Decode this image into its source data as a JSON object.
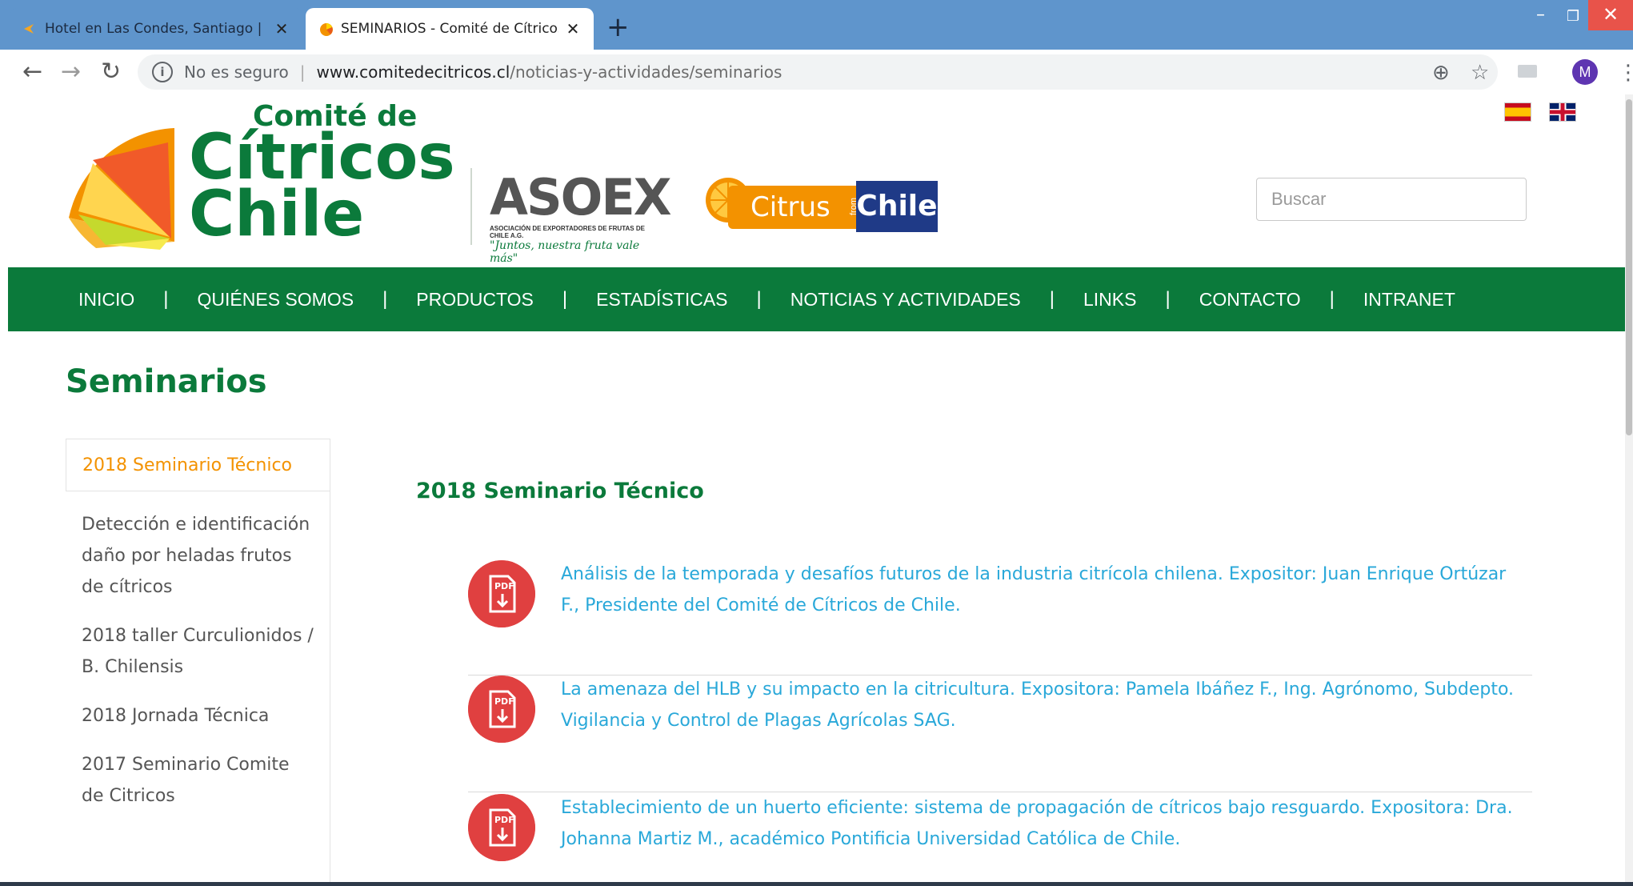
{
  "browser": {
    "tabs": [
      {
        "title": "Hotel en Las Condes, Santiago | "
      },
      {
        "title": "SEMINARIOS - Comité de Cítricos"
      }
    ],
    "close_glyph": "✕",
    "new_tab_glyph": "+",
    "window_controls": {
      "minimize": "–",
      "restore": "❐",
      "close": "✕"
    },
    "nav": {
      "back": "←",
      "forward": "→",
      "reload": "↻"
    },
    "address": {
      "info_glyph": "i",
      "security_text": "No es seguro",
      "separator": "|",
      "domain": "www.comitedecitricos.cl",
      "path": "/noticias-y-actividades/seminarios"
    },
    "toolbar_icons": {
      "zoom": "⊕",
      "star": "☆",
      "menu": "⋮"
    },
    "avatar_letter": "M"
  },
  "site": {
    "logo": {
      "line1": "Comité de",
      "line2": "Cítricos",
      "line3": "Chile"
    },
    "partner_logo": {
      "word": "ASOEX",
      "sub": "ASOCIACIÓN DE EXPORTADORES DE FRUTAS DE CHILE A.G.",
      "tagline": "\"Juntos, nuestra fruta vale más\""
    },
    "citrus_logo": {
      "citrus": "Citrus",
      "from": "from",
      "chile": "Chile"
    },
    "search_placeholder": "Buscar",
    "nav": {
      "separator": "|",
      "items": [
        "INICIO",
        "QUIÉNES SOMOS",
        "PRODUCTOS",
        "ESTADÍSTICAS",
        "NOTICIAS Y ACTIVIDADES",
        "LINKS",
        "CONTACTO",
        "INTRANET"
      ]
    }
  },
  "page": {
    "title": "Seminarios",
    "sidebar": {
      "active": "2018 Seminario Técnico",
      "items": [
        "Detección e identificación daño por heladas frutos de cítricos",
        "2018 taller Curculionidos / B. Chilensis",
        "2018 Jornada Técnica",
        "2017 Seminario Comite de Citricos"
      ]
    },
    "section_heading": "2018 Seminario Técnico",
    "pdf_label": "PDF",
    "entries": [
      "Análisis de la temporada y desafíos futuros de la industria citrícola chilena. Expositor: Juan Enrique Ortúzar F., Presidente del Comité de Cítricos de Chile.",
      "La amenaza del HLB y su impacto en la citricultura. Expositora: Pamela Ibáñez F., Ing. Agrónomo, Subdepto. Vigilancia y Control de Plagas Agrícolas SAG.",
      "Establecimiento de un huerto eficiente: sistema de propagación de cítricos bajo resguardo. Expositora: Dra. Johanna Martiz M., académico Pontificia Universidad Católica de Chile."
    ]
  },
  "colors": {
    "brand_green": "#0b7a3b",
    "accent_orange": "#f39200",
    "link_blue": "#29a8d9",
    "pdf_red": "#e04040",
    "chrome_blue": "#5f95cc"
  }
}
